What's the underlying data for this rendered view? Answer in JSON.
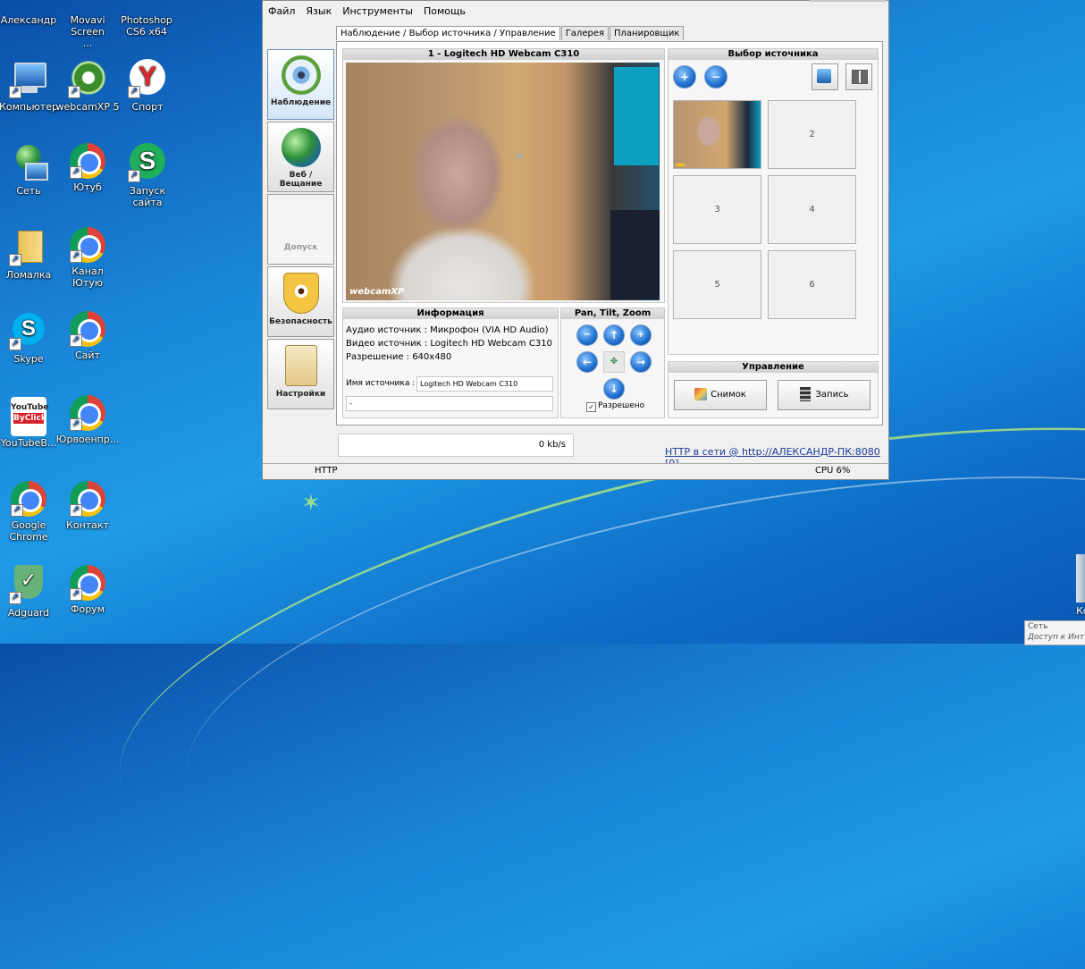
{
  "desktop": {
    "icons": [
      {
        "id": "alexander",
        "label": "Александр",
        "icon": "user-folder-icon"
      },
      {
        "id": "movavi",
        "label": "Movavi Screen ...",
        "icon": "movavi-icon"
      },
      {
        "id": "photoshop",
        "label": "Photoshop CS6 x64",
        "icon": "photoshop-icon"
      },
      {
        "id": "computer",
        "label": "Компьютер",
        "icon": "computer-icon"
      },
      {
        "id": "webcamxp",
        "label": "webcamXP 5",
        "icon": "webcam-icon"
      },
      {
        "id": "sport",
        "label": "Спорт",
        "icon": "yandex-icon"
      },
      {
        "id": "network",
        "label": "Сеть",
        "icon": "network-icon"
      },
      {
        "id": "youtube",
        "label": "Ютуб",
        "icon": "chrome-icon"
      },
      {
        "id": "launch",
        "label": "Запуск сайта",
        "icon": "site-s-icon"
      },
      {
        "id": "lomalka",
        "label": "Ломалка",
        "icon": "folder-icon"
      },
      {
        "id": "channel",
        "label": "Канал Ютую",
        "icon": "chrome-icon"
      },
      {
        "id": "skype",
        "label": "Skype",
        "icon": "skype-icon"
      },
      {
        "id": "site",
        "label": "Сайт",
        "icon": "chrome-icon"
      },
      {
        "id": "ytbyclick",
        "label": "YouTubeB...",
        "icon": "youtube-byclick-icon"
      },
      {
        "id": "yurvoen",
        "label": "Юрвоенпр...",
        "icon": "chrome-icon"
      },
      {
        "id": "gchrome",
        "label": "Google Chrome",
        "icon": "chrome-icon"
      },
      {
        "id": "contact",
        "label": "Контакт",
        "icon": "chrome-icon"
      },
      {
        "id": "adguard",
        "label": "Adguard",
        "icon": "adguard-icon"
      },
      {
        "id": "forum",
        "label": "Форум",
        "icon": "chrome-icon"
      }
    ],
    "ytbyclick_logo_top": "YouTube",
    "ytbyclick_logo_bottom": "ByClick",
    "tray": {
      "line1": "Сеть",
      "line2": "Доступ к Инт"
    },
    "edge_label": "Ко"
  },
  "app": {
    "menu": [
      "Файл",
      "Язык",
      "Инструменты",
      "Помощь"
    ],
    "left_panel": [
      {
        "label": "Наблюдение",
        "icon": "eye-camera-icon",
        "active": true
      },
      {
        "label": "Веб / Вещание",
        "icon": "globe-broadcast-icon",
        "active": false
      },
      {
        "label": "Допуск",
        "icon": "access-icon",
        "active": false
      },
      {
        "label": "Безопасность",
        "icon": "shield-eye-icon",
        "active": false
      },
      {
        "label": "Настройки",
        "icon": "settings-clipboard-icon",
        "active": false
      }
    ],
    "tabs": [
      "Наблюдение / Выбор источника / Управление",
      "Галерея",
      "Планировщик"
    ],
    "video_title": "1 - Logitech HD Webcam C310",
    "video_watermark": "webcamXP",
    "info": {
      "title": "Информация",
      "audio": "Аудио источник : Микрофон (VIA HD Audio)",
      "video": "Видео источник : Logitech HD Webcam C310",
      "resolution": "Разрешение : 640x480",
      "name_label": "Имя источника :",
      "name_value": "Logitech HD Webcam C310",
      "extra_value": "-"
    },
    "ptz": {
      "title": "Pan, Tilt, Zoom",
      "enabled_label": "Разрешено",
      "enabled": true
    },
    "source": {
      "title": "Выбор источника",
      "cells": [
        "",
        "2",
        "3",
        "4",
        "5",
        "6"
      ]
    },
    "control": {
      "title": "Управление",
      "snapshot": "Снимок",
      "record": "Запись"
    },
    "bandwidth": "0 kb/s",
    "http_link": "HTTP в сети @ http://АЛЕКСАНДР-ПК:8080 [0]",
    "status": {
      "left": "HTTP",
      "right": "CPU 6%"
    }
  }
}
